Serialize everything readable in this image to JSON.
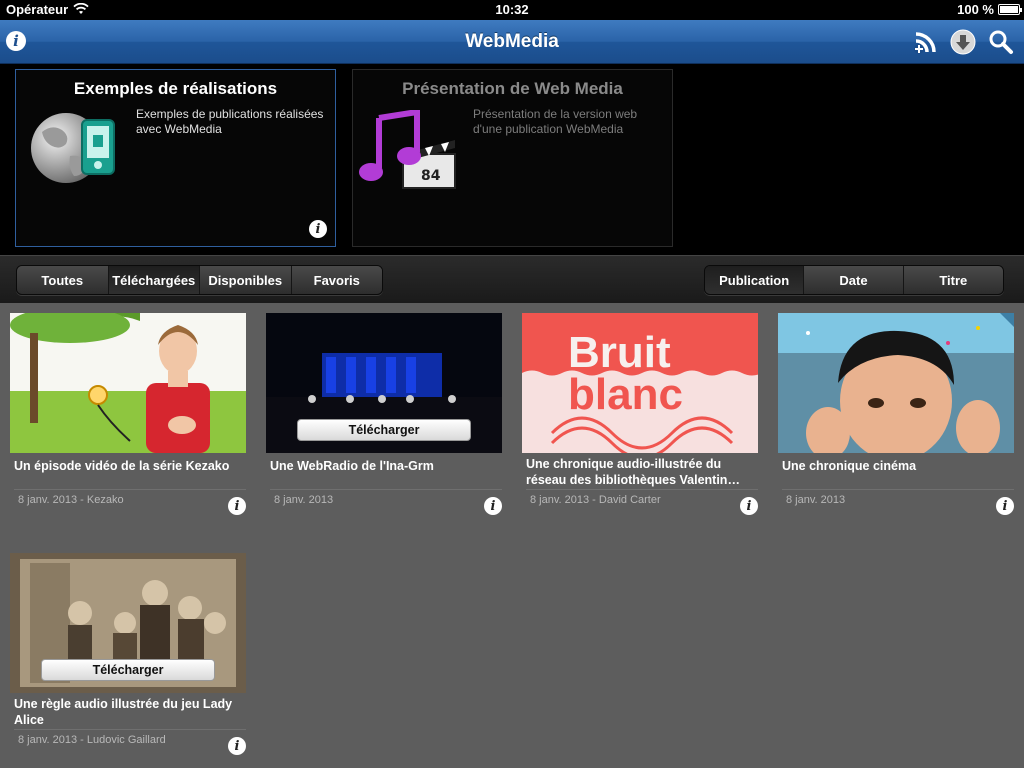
{
  "status_bar": {
    "carrier": "Opérateur",
    "time": "10:32",
    "battery": "100 %"
  },
  "navbar": {
    "title": "WebMedia",
    "info_icon": "info-icon",
    "rss_icon": "rss-add-icon",
    "download_icon": "download-icon",
    "search_icon": "search-icon"
  },
  "featured": [
    {
      "title": "Exemples de réalisations",
      "description": "Exemples de publications réalisées avec WebMedia",
      "icon": "globe-phone-icon",
      "selected": true
    },
    {
      "title": "Présentation de Web Media",
      "description": "Présentation de la version web d'une publication WebMedia",
      "icon": "music-clapper-icon",
      "selected": false
    }
  ],
  "filters": {
    "tabs": [
      "Toutes",
      "Téléchargées",
      "Disponibles",
      "Favoris"
    ],
    "active": "Téléchargées"
  },
  "sort": {
    "tabs": [
      "Publication",
      "Date",
      "Titre"
    ],
    "active": "Publication"
  },
  "download_label": "Télécharger",
  "thumb_texts": {
    "bruit": "Bruit",
    "blanc": "blanc"
  },
  "items": [
    {
      "title": "Un épisode vidéo de la série Kezako",
      "meta": "8 janv. 2013 - Kezako",
      "downloadable": false
    },
    {
      "title": "Une WebRadio de l'Ina-Grm",
      "meta": "8 janv. 2013",
      "downloadable": true
    },
    {
      "title": "Une chronique audio-illustrée du réseau des bibliothèques Valentin…",
      "meta": "8 janv. 2013 - David Carter",
      "downloadable": false
    },
    {
      "title": "Une chronique cinéma",
      "meta": "8 janv. 2013",
      "downloadable": false
    },
    {
      "title": "Une règle audio illustrée du jeu Lady Alice",
      "meta": "8 janv. 2013 - Ludovic Gaillard",
      "downloadable": true
    }
  ],
  "colors": {
    "nav_blue": "#2a63a8",
    "grid_bg": "#5d5d5d",
    "bruit_red": "#f0554f"
  }
}
